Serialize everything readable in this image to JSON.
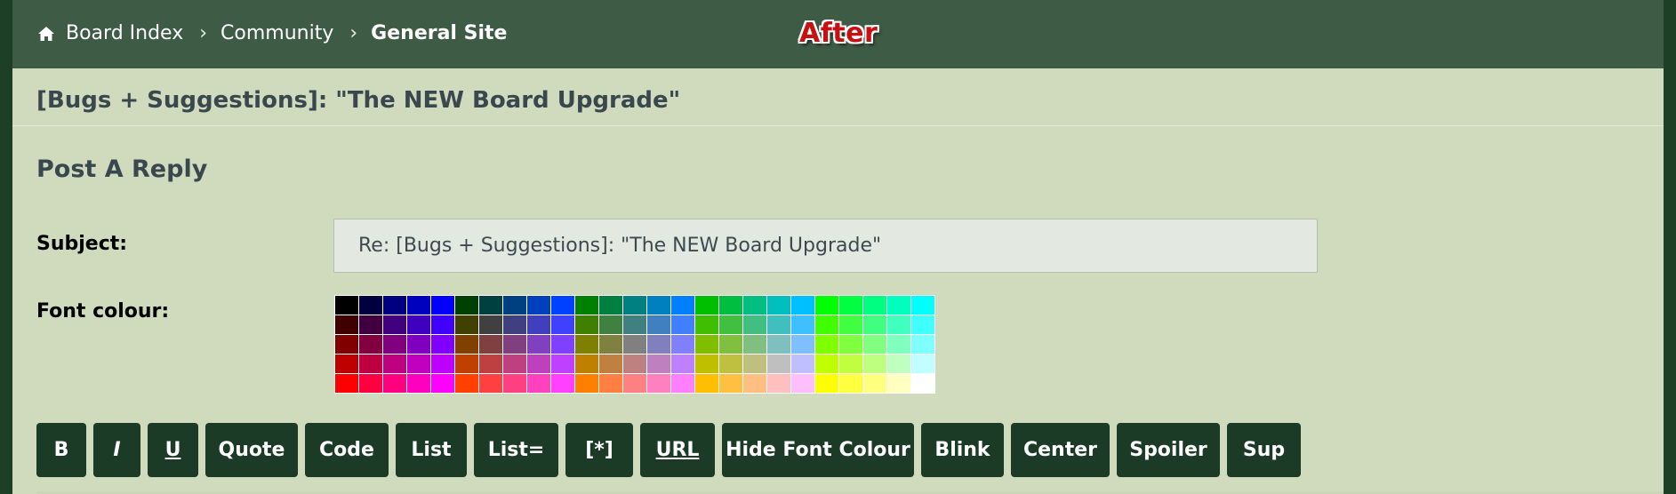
{
  "breadcrumb": {
    "home_icon": "home-icon",
    "items": [
      "Board Index",
      "Community",
      "General Site"
    ],
    "separator": "›"
  },
  "badge": {
    "text": "After",
    "color": "#c81010"
  },
  "topic": {
    "title": "[Bugs + Suggestions]: \"The NEW Board Upgrade\""
  },
  "form": {
    "heading": "Post A Reply",
    "subject_label": "Subject:",
    "subject_value": "Re: [Bugs + Suggestions]: \"The NEW Board Upgrade\"",
    "font_colour_label": "Font colour:"
  },
  "palette": {
    "rows": [
      [
        "#000000",
        "#000040",
        "#000080",
        "#0000BF",
        "#0000FF",
        "#004000",
        "#004040",
        "#004080",
        "#0040BF",
        "#0040FF",
        "#008000",
        "#008040",
        "#008080",
        "#0080BF",
        "#0080FF",
        "#00BF00",
        "#00BF40",
        "#00BF80",
        "#00BFBF",
        "#00BFFF",
        "#00FF00",
        "#00FF40",
        "#00FF80",
        "#00FFBF",
        "#00FFFF"
      ],
      [
        "#400000",
        "#400040",
        "#400080",
        "#4000BF",
        "#4000FF",
        "#404000",
        "#404040",
        "#404080",
        "#4040BF",
        "#4040FF",
        "#408000",
        "#408040",
        "#408080",
        "#4080BF",
        "#4080FF",
        "#40BF00",
        "#40BF40",
        "#40BF80",
        "#40BFBF",
        "#40BFFF",
        "#40FF00",
        "#40FF40",
        "#40FF80",
        "#40FFBF",
        "#40FFFF"
      ],
      [
        "#800000",
        "#800040",
        "#800080",
        "#8000BF",
        "#8000FF",
        "#804000",
        "#804040",
        "#804080",
        "#8040BF",
        "#8040FF",
        "#808000",
        "#808040",
        "#808080",
        "#8080BF",
        "#8080FF",
        "#80BF00",
        "#80BF40",
        "#80BF80",
        "#80BFBF",
        "#80BFFF",
        "#80FF00",
        "#80FF40",
        "#80FF80",
        "#80FFBF",
        "#80FFFF"
      ],
      [
        "#BF0000",
        "#BF0040",
        "#BF0080",
        "#BF00BF",
        "#BF00FF",
        "#BF4000",
        "#BF4040",
        "#BF4080",
        "#BF40BF",
        "#BF40FF",
        "#BF8000",
        "#BF8040",
        "#BF8080",
        "#BF80BF",
        "#BF80FF",
        "#BFBF00",
        "#BFBF40",
        "#BFBF80",
        "#BFBFBF",
        "#BFBFFF",
        "#BFFF00",
        "#BFFF40",
        "#BFFF80",
        "#BFFFBF",
        "#BFFFFF"
      ],
      [
        "#FF0000",
        "#FF0040",
        "#FF0080",
        "#FF00BF",
        "#FF00FF",
        "#FF4000",
        "#FF4040",
        "#FF4080",
        "#FF40BF",
        "#FF40FF",
        "#FF8000",
        "#FF8040",
        "#FF8080",
        "#FF80BF",
        "#FF80FF",
        "#FFBF00",
        "#FFBF40",
        "#FFBF80",
        "#FFBFBF",
        "#FFBFFF",
        "#FFFF00",
        "#FFFF40",
        "#FFFF80",
        "#FFFFBF",
        "#FFFFFF"
      ]
    ]
  },
  "toolbar": {
    "buttons": [
      {
        "label": "B",
        "name": "bold-button",
        "style": ""
      },
      {
        "label": "I",
        "name": "italic-button",
        "style": "italic"
      },
      {
        "label": "U",
        "name": "underline-button",
        "style": "underline"
      },
      {
        "label": "Quote",
        "name": "quote-button",
        "style": ""
      },
      {
        "label": "Code",
        "name": "code-button",
        "style": ""
      },
      {
        "label": "List",
        "name": "list-button",
        "style": ""
      },
      {
        "label": "List=",
        "name": "ordered-list-button",
        "style": ""
      },
      {
        "label": "[*]",
        "name": "list-item-button",
        "style": ""
      },
      {
        "label": "URL",
        "name": "url-button",
        "style": "underline"
      },
      {
        "label": "Hide Font Colour",
        "name": "hide-font-colour-button",
        "style": ""
      },
      {
        "label": "Blink",
        "name": "blink-button",
        "style": ""
      },
      {
        "label": "Center",
        "name": "center-button",
        "style": ""
      },
      {
        "label": "Spoiler",
        "name": "spoiler-button",
        "style": ""
      },
      {
        "label": "Sup",
        "name": "sup-button",
        "style": ""
      }
    ]
  },
  "colors": {
    "navbar": "#3e5b45",
    "content_bg": "#d0dbbd",
    "button_bg": "#1b3b27",
    "outer_bg": "#1d3f25"
  }
}
